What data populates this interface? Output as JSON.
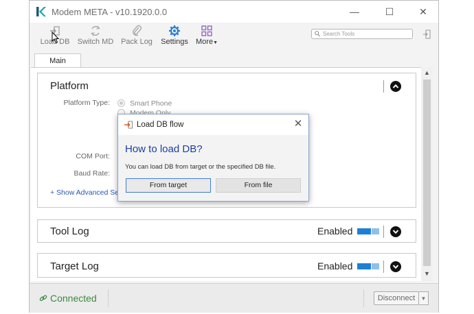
{
  "window": {
    "title": "Modem META - v10.1920.0.0",
    "controls": {
      "minimize": "—",
      "maximize": "☐",
      "close": "✕"
    }
  },
  "toolbar": {
    "items": [
      {
        "label": "Load DB",
        "icon": "load-db-icon"
      },
      {
        "label": "Switch MD",
        "icon": "switch-icon"
      },
      {
        "label": "Pack Log",
        "icon": "paperclip-icon"
      },
      {
        "label": "Settings",
        "icon": "gear-icon"
      },
      {
        "label": "More",
        "icon": "grid-icon"
      }
    ],
    "search_placeholder": "Search Tools"
  },
  "tabs": [
    {
      "label": "Main"
    }
  ],
  "platform": {
    "title": "Platform",
    "platform_type_label": "Platform Type:",
    "options": [
      "Smart Phone",
      "Modem Only"
    ],
    "selected": "Smart Phone",
    "com_port_label": "COM Port:",
    "baud_rate_label": "Baud Rate:",
    "advanced_link": "+ Show Advanced Se"
  },
  "tool_log": {
    "title": "Tool Log",
    "status": "Enabled"
  },
  "target_log": {
    "title": "Target Log",
    "status": "Enabled"
  },
  "status_bar": {
    "connection": "Connected",
    "disconnect_label": "Disconnect"
  },
  "dialog": {
    "title": "Load DB flow",
    "heading": "How to load DB?",
    "message": "You can load DB from target or the specified DB file.",
    "buttons": {
      "from_target": "From target",
      "from_file": "From file"
    }
  },
  "colors": {
    "accent_blue": "#1c3fa0",
    "toggle_blue": "#1e7fd6",
    "connected_green": "#3c8a3c",
    "gear_blue": "#2a7fd4",
    "grid_purple": "#9b6cc5",
    "dialog_icon_orange": "#e05a2a"
  }
}
